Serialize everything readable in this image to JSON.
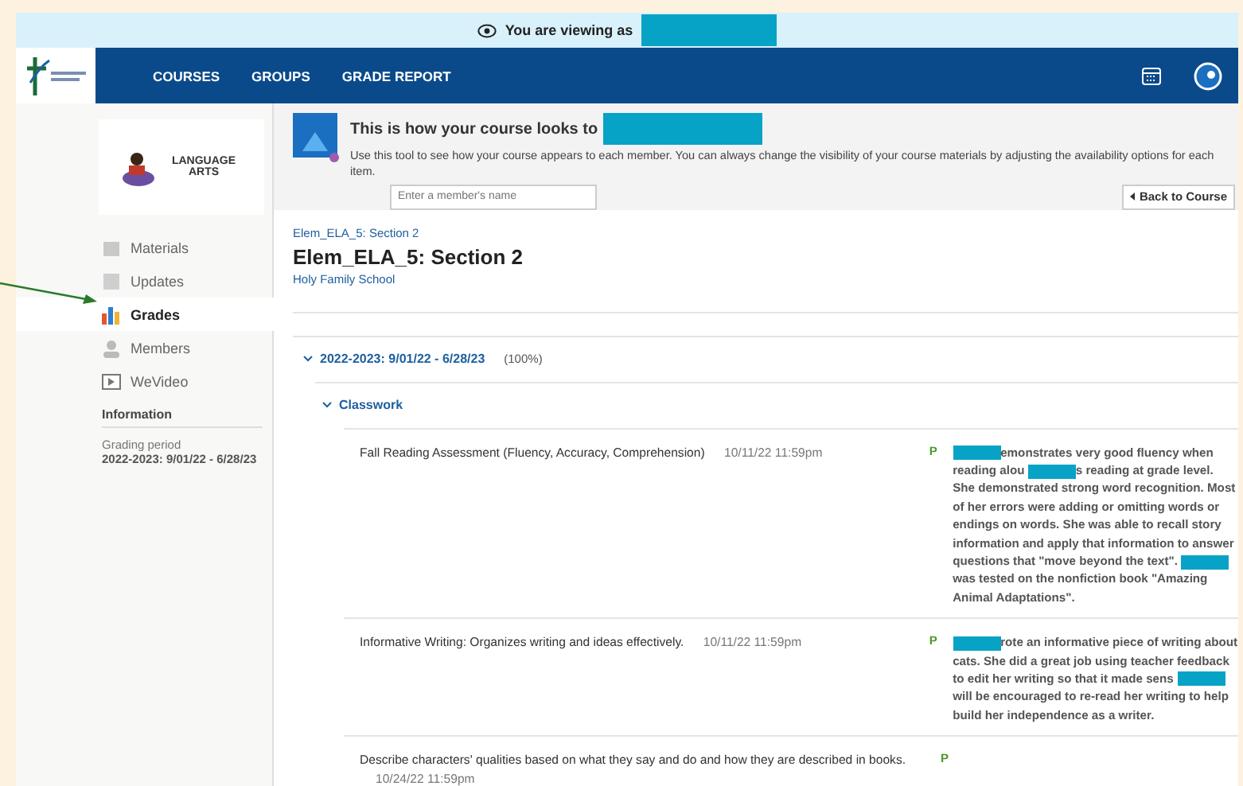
{
  "banner": {
    "text": "You are viewing as"
  },
  "nav": {
    "items": [
      {
        "label": "COURSES"
      },
      {
        "label": "GROUPS"
      },
      {
        "label": "GRADE REPORT"
      }
    ]
  },
  "course_card": {
    "title": "LANGUAGE ARTS"
  },
  "sidebar": {
    "items": [
      {
        "label": "Materials",
        "selected": false
      },
      {
        "label": "Updates",
        "selected": false
      },
      {
        "label": "Grades",
        "selected": true
      },
      {
        "label": "Members",
        "selected": false
      },
      {
        "label": "WeVideo",
        "selected": false
      }
    ],
    "info_heading": "Information",
    "info_label": "Grading period",
    "info_value": "2022-2023: 9/01/22 - 6/28/23"
  },
  "preview": {
    "title": "This is how your course looks to",
    "description": "Use this tool to see how your course appears to each member. You can always change the visibility of your course materials by adjusting the availability options for each item.",
    "placeholder": "Enter a member's name",
    "back_button": "Back to Course"
  },
  "course": {
    "breadcrumb": "Elem_ELA_5: Section 2",
    "title": "Elem_ELA_5: Section 2",
    "school": "Holy Family School"
  },
  "period": {
    "label": "2022-2023: 9/01/22 - 6/28/23",
    "percent": "(100%)",
    "expanded": true
  },
  "category": {
    "label": "Classwork",
    "expanded": true
  },
  "rows": [
    {
      "title": "Fall Reading Assessment (Fluency, Accuracy, Comprehension)",
      "date": "10/11/22 11:59pm",
      "grade": "P",
      "comment": [
        {
          "kind": "redacted"
        },
        {
          "kind": "text",
          "text": "emonstrates very good fluency when reading alou"
        },
        {
          "kind": "redacted"
        },
        {
          "kind": "text",
          "text": "s reading at grade level. She demonstrated strong word recognition. Most of her errors were adding or omitting words or endings on words. She was able to recall story information and apply that information to answer questions that \"move beyond the text\"."
        },
        {
          "kind": "redacted"
        },
        {
          "kind": "text",
          "text": "was tested on the nonfiction book \"Amazing Animal Adaptations\"."
        }
      ]
    },
    {
      "title": "Informative Writing: Organizes writing and ideas effectively.",
      "date": "10/11/22 11:59pm",
      "grade": "P",
      "comment": [
        {
          "kind": "redacted"
        },
        {
          "kind": "text",
          "text": "rote an informative piece of writing about cats. She did a great job using teacher feedback to edit her writing so that it made sens"
        },
        {
          "kind": "redacted"
        },
        {
          "kind": "text",
          "text": "will be encouraged to re-read her writing to help build her independence as a writer."
        }
      ]
    },
    {
      "title": "Describe characters' qualities based on what they say and do and how they are described in books.",
      "date": "10/24/22 11:59pm",
      "grade": "P",
      "comment": []
    }
  ]
}
